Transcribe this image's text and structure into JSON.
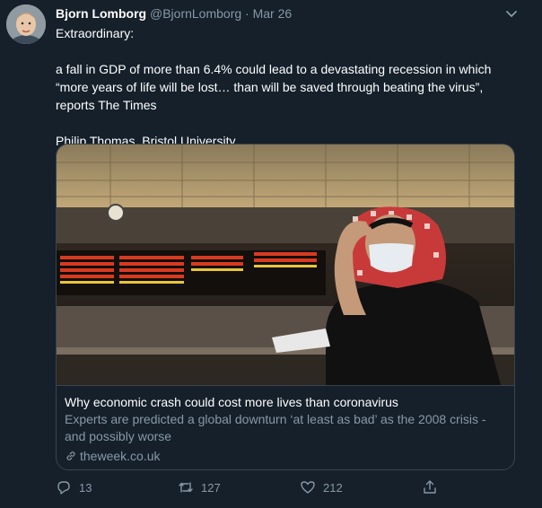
{
  "tweet": {
    "display_name": "Bjorn Lomborg",
    "handle": "@BjornLomborg",
    "separator": "·",
    "date": "Mar 26",
    "text": {
      "line1": "Extraordinary:",
      "line2": "a fall in GDP of more than 6.4% could lead to a devastating recession in which “more years of life will be lost… than will be saved through beating the virus”, reports The Times",
      "line3": "Philip Thomas, Bristol University"
    }
  },
  "card": {
    "title": "Why economic crash could cost more lives than coronavirus",
    "description": "Experts are predicted a global downturn ‘at least as bad’ as the 2008 crisis - and possibly worse",
    "domain": "theweek.co.uk"
  },
  "actions": {
    "replies": "13",
    "retweets": "127",
    "likes": "212"
  },
  "icons": {
    "reply": "reply-icon",
    "retweet": "retweet-icon",
    "like": "heart-icon",
    "share": "share-icon",
    "link": "link-icon",
    "more": "chevron-down-icon"
  },
  "colors": {
    "background": "#15202b",
    "secondary_text": "#8899a6",
    "border": "#38444d"
  }
}
